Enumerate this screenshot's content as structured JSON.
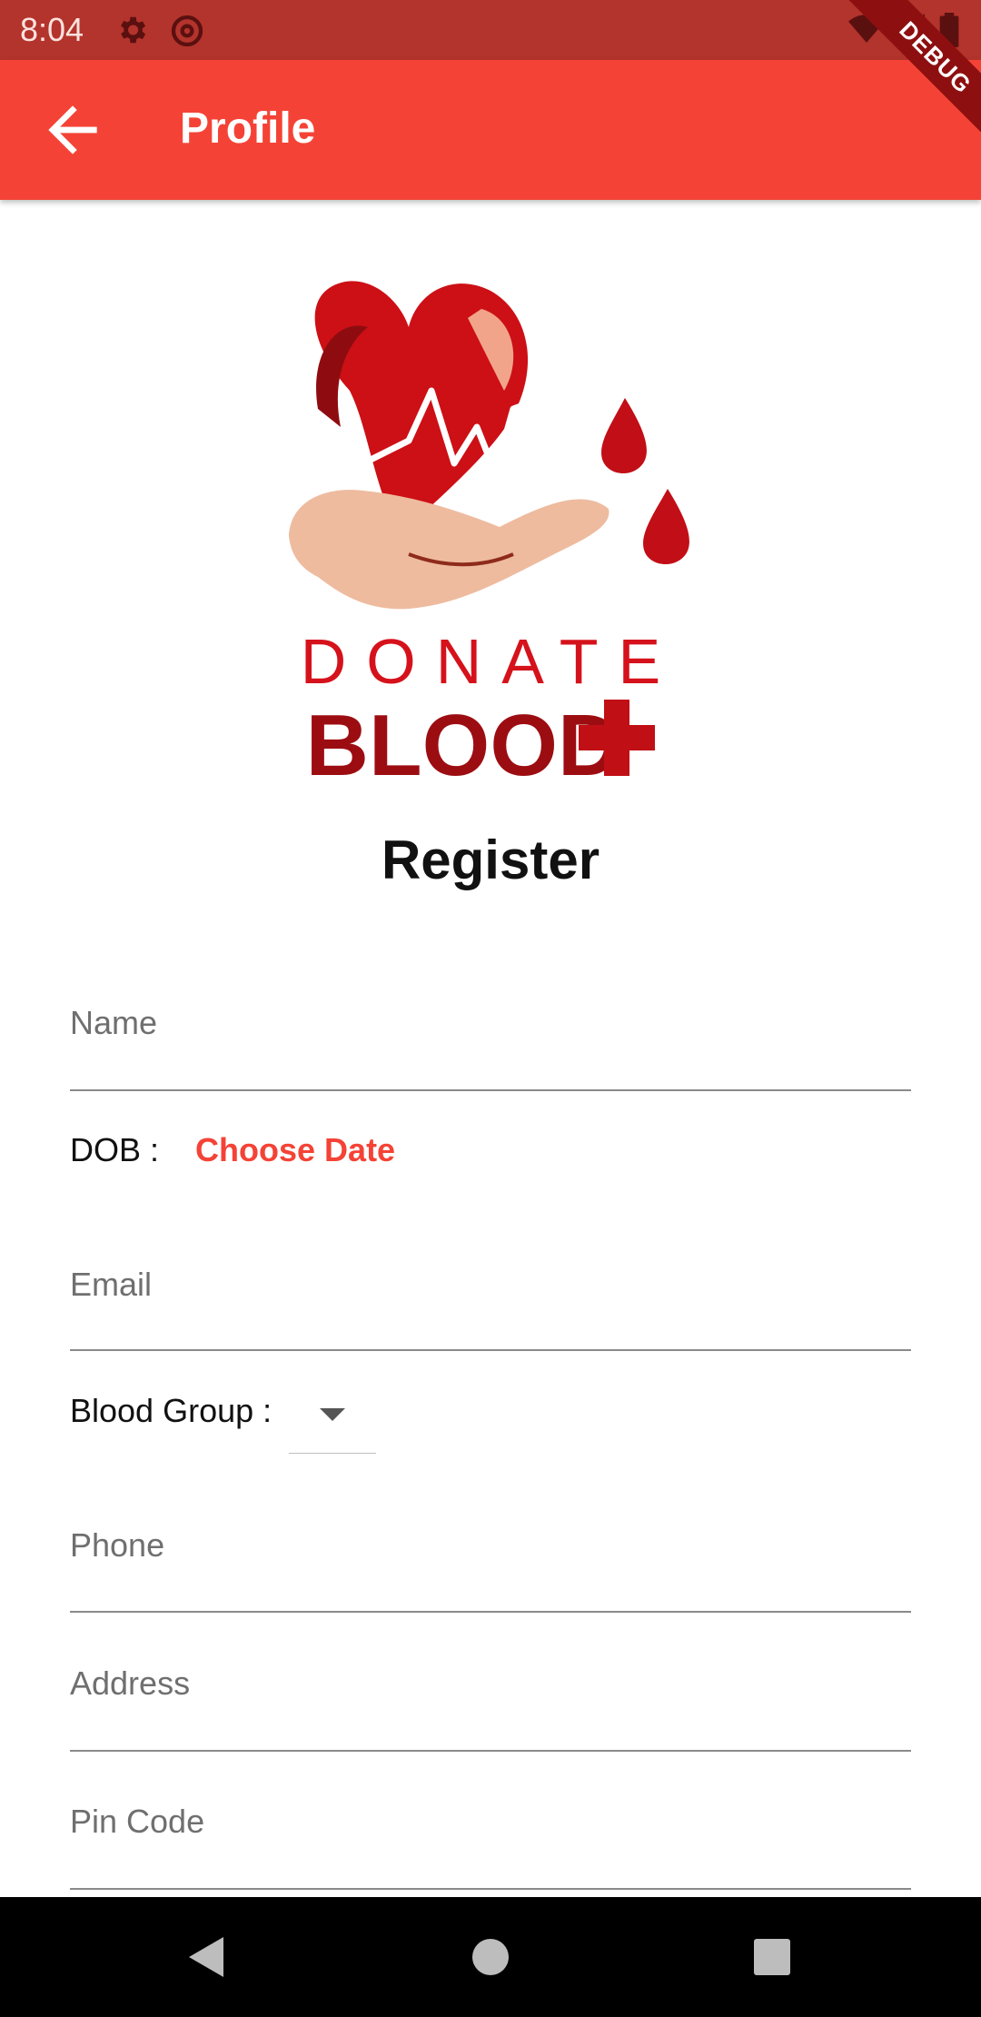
{
  "status_bar": {
    "time": "8:04",
    "icons": [
      "settings-icon",
      "at-sign-icon",
      "wifi-icon",
      "signal-icon",
      "battery-icon"
    ],
    "debug_label": "DEBUG"
  },
  "app_bar": {
    "title": "Profile",
    "back_icon": "arrow-back-icon",
    "color": "#f44336"
  },
  "logo": {
    "line1": "DONATE",
    "line2": "BLOOD"
  },
  "form": {
    "heading": "Register",
    "name_label": "Name",
    "dob_label": "DOB :",
    "dob_action": "Choose Date",
    "email_label": "Email",
    "blood_group_label": "Blood Group :",
    "phone_label": "Phone",
    "address_label": "Address",
    "pin_label": "Pin Code"
  },
  "nav_bar": {
    "icons": [
      "back-triangle-icon",
      "home-circle-icon",
      "recents-square-icon"
    ]
  }
}
